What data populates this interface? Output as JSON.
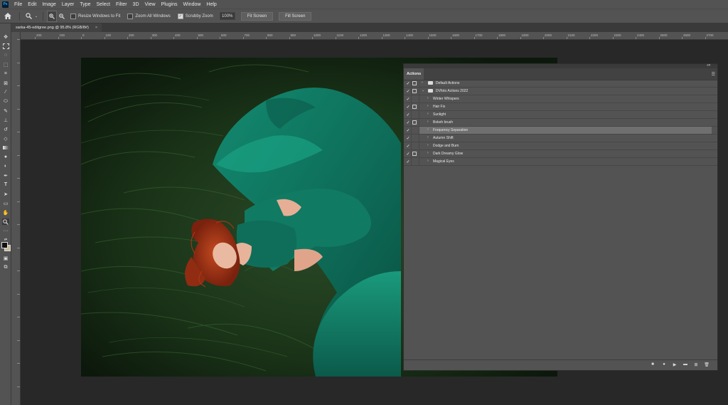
{
  "app": {
    "logo": "Ps"
  },
  "menu": [
    "File",
    "Edit",
    "Image",
    "Layer",
    "Type",
    "Select",
    "Filter",
    "3D",
    "View",
    "Plugins",
    "Window",
    "Help"
  ],
  "options": {
    "zoom_value": "100%",
    "resize_windows_label": "Resize Windows to Fit",
    "zoom_all_label": "Zoom All Windows",
    "scrubby_label": "Scrubby Zoom",
    "fit_screen_label": "Fit Screen",
    "fill_screen_label": "Fill Screen"
  },
  "document": {
    "tab_title": "sarka-45-editgree.png @ 95.8% (RGB/8#)",
    "close": "×"
  },
  "ruler_ticks": [
    "200",
    "100",
    "0",
    "100",
    "200",
    "300",
    "400",
    "500",
    "600",
    "700",
    "800",
    "900",
    "1000",
    "1100",
    "1200",
    "1300",
    "1400",
    "1500",
    "1600",
    "1700",
    "1800",
    "1900",
    "2000",
    "2100",
    "2200",
    "2300",
    "2400",
    "2500",
    "2600",
    "2700"
  ],
  "actions_panel": {
    "tab_label": "Actions",
    "items": [
      {
        "label": "Default Actions",
        "type": "set",
        "checked": true,
        "dialog": true,
        "expanded": false
      },
      {
        "label": "DVfoto Actions 2022",
        "type": "set",
        "checked": true,
        "dialog": true,
        "expanded": true
      },
      {
        "label": "Winter Whispers",
        "type": "action",
        "checked": true,
        "dialog": false
      },
      {
        "label": "Hair Fix",
        "type": "action",
        "checked": true,
        "dialog": true
      },
      {
        "label": "Sunlight",
        "type": "action",
        "checked": true,
        "dialog": false
      },
      {
        "label": "Bokeh brush",
        "type": "action",
        "checked": true,
        "dialog": true
      },
      {
        "label": "Frequency Separation",
        "type": "action",
        "checked": true,
        "dialog": false,
        "selected": true
      },
      {
        "label": "Autumn Shift",
        "type": "action",
        "checked": true,
        "dialog": false
      },
      {
        "label": "Dodge and Burn",
        "type": "action",
        "checked": true,
        "dialog": false
      },
      {
        "label": "Dark Dreamy Glow",
        "type": "action",
        "checked": true,
        "dialog": true
      },
      {
        "label": "Magical Eyes",
        "type": "action",
        "checked": true,
        "dialog": false
      }
    ]
  },
  "colors": {
    "accent": "#31a8ff",
    "dress": "#0f6b5a",
    "grass": "#1f3a1c",
    "hair": "#a83a1c"
  }
}
